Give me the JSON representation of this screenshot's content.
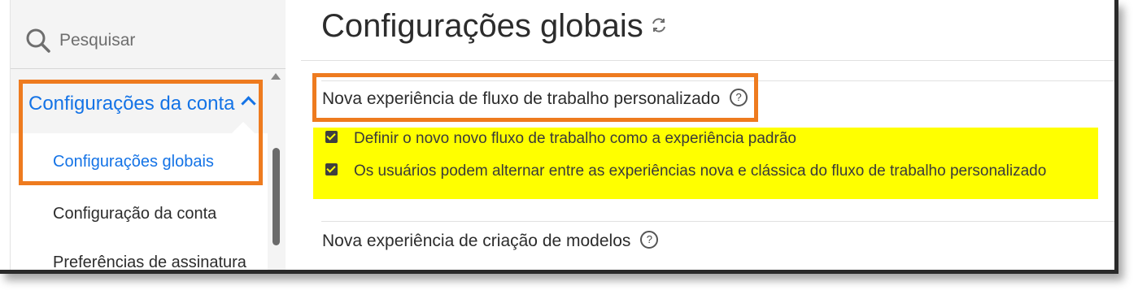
{
  "sidebar": {
    "search_label": "Pesquisar",
    "group_label": "Configurações da conta",
    "items": [
      {
        "label": "Configurações globais",
        "active": true
      },
      {
        "label": "Configuração da conta",
        "active": false
      },
      {
        "label": "Preferências de assinatura",
        "active": false
      }
    ]
  },
  "main": {
    "title": "Configurações globais",
    "sections": [
      {
        "title": "Nova experiência de fluxo de trabalho personalizado",
        "options": [
          {
            "label": "Definir o novo novo fluxo de trabalho como a experiência padrão",
            "checked": true
          },
          {
            "label": "Os usuários podem alternar entre as experiências nova e clássica do fluxo de trabalho personalizado",
            "checked": true
          }
        ]
      },
      {
        "title": "Nova experiência de criação de modelos",
        "options": []
      }
    ],
    "help_glyph": "?"
  },
  "colors": {
    "accent": "#1473e6",
    "annotation_box": "#ee7b1f",
    "highlight": "#ffff00"
  }
}
